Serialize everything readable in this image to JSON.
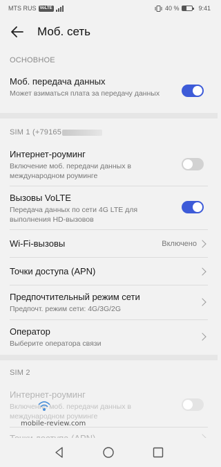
{
  "status_bar": {
    "carrier": "MTS RUS",
    "volte": "VoLTE",
    "battery_text": "40 %",
    "battery_level": 0.4,
    "time": "9:41"
  },
  "header": {
    "title": "Моб. сеть"
  },
  "section_main": {
    "label": "ОСНОВНОЕ"
  },
  "mobile_data": {
    "title": "Моб. передача данных",
    "subtitle": "Может взиматься плата за передачу данных",
    "enabled": true
  },
  "sim1": {
    "label": "SIM 1 (+79165",
    "roaming": {
      "title": "Интернет-роуминг",
      "subtitle": "Включение моб. передачи данных в международном роуминге",
      "enabled": false
    },
    "volte_calls": {
      "title": "Вызовы VoLTE",
      "subtitle": "Передача данных по сети 4G LTE для выполнения HD-вызовов",
      "enabled": true
    },
    "wifi_calls": {
      "title": "Wi-Fi-вызовы",
      "value": "Включено"
    },
    "apn": {
      "title": "Точки доступа (APN)"
    },
    "network_mode": {
      "title": "Предпочтительный режим сети",
      "subtitle": "Предпочт. режим сети: 4G/3G/2G"
    },
    "operator": {
      "title": "Оператор",
      "subtitle": "Выберите оператора связи"
    }
  },
  "sim2": {
    "label": "SIM 2",
    "roaming": {
      "title": "Интернет-роуминг",
      "subtitle": "Включение моб. передачи данных в международном роуминге",
      "enabled": false
    },
    "apn": {
      "title": "Точки доступа (APN)"
    }
  },
  "watermark": {
    "text": "mobile-review.com"
  },
  "colors": {
    "accent": "#3d5bd8",
    "background": "#f2f2f2"
  }
}
